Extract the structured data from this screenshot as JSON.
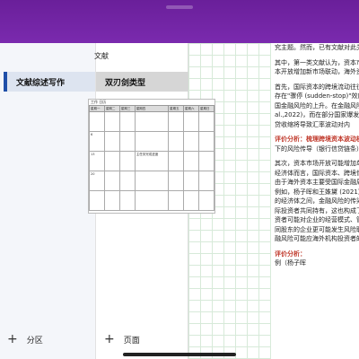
{
  "notebook": {
    "title": "文献"
  },
  "sections": [
    {
      "label": "文献综述写作",
      "selected": true
    }
  ],
  "pages": [
    {
      "label": "双刃剑类型",
      "selected": true
    }
  ],
  "buttons": {
    "add_section": "分区",
    "add_page": "页面"
  },
  "calendar": {
    "caption": "工作 日历",
    "headers": [
      "星期一",
      "星期二",
      "星期三",
      "星期四",
      "星期五",
      "星期六",
      "星期日"
    ],
    "rows": [
      [
        "",
        "",
        "",
        "",
        "",
        "",
        ""
      ],
      [
        "6",
        "",
        "",
        "",
        "",
        "",
        ""
      ],
      [
        "13",
        "",
        "",
        "",
        "",
        "",
        ""
      ],
      [
        "20",
        "",
        "",
        "",
        "",
        "",
        ""
      ],
      [
        "",
        "",
        "",
        "",
        "",
        "",
        ""
      ]
    ],
    "note": "主任务完成进度"
  },
  "document": {
    "paragraphs": [
      "究主题。然而，已有文献对此关注",
      "其中，第一类文献认为，资本市场",
      "本开放增加新市场联动，海外资",
      "首先，国际资本的跨境流动往往",
      "存在\"骤停 (sudden-stop)\"效应",
      "国金融风险的上升。在金融风险",
      "al.,2022)，而在部分国家爆发金融",
      "贷收缩将导致汇率波动对内",
      "评价分析：梳理跨境资本波动机制",
      "下的风险传导（银行信贷链条）",
      "其次，资本市场开放可能增加单一",
      "经济体而言，国际资本、跨境借贷",
      "由于海外资本主要受国际金融周期",
      "例如，杨子晖和王姝黛 (2021) 研究",
      "的经济体之间，金融风险的传染",
      "际投资者共同持有，这也构成了金融",
      "资者可能对企业的经营模式、管理",
      "同股东的企业更可能发生风险联动",
      "融风险可能应海外机构投资者的",
      "评价分析：",
      "例（杨子晖"
    ],
    "highlighted": [
      8,
      19
    ]
  }
}
